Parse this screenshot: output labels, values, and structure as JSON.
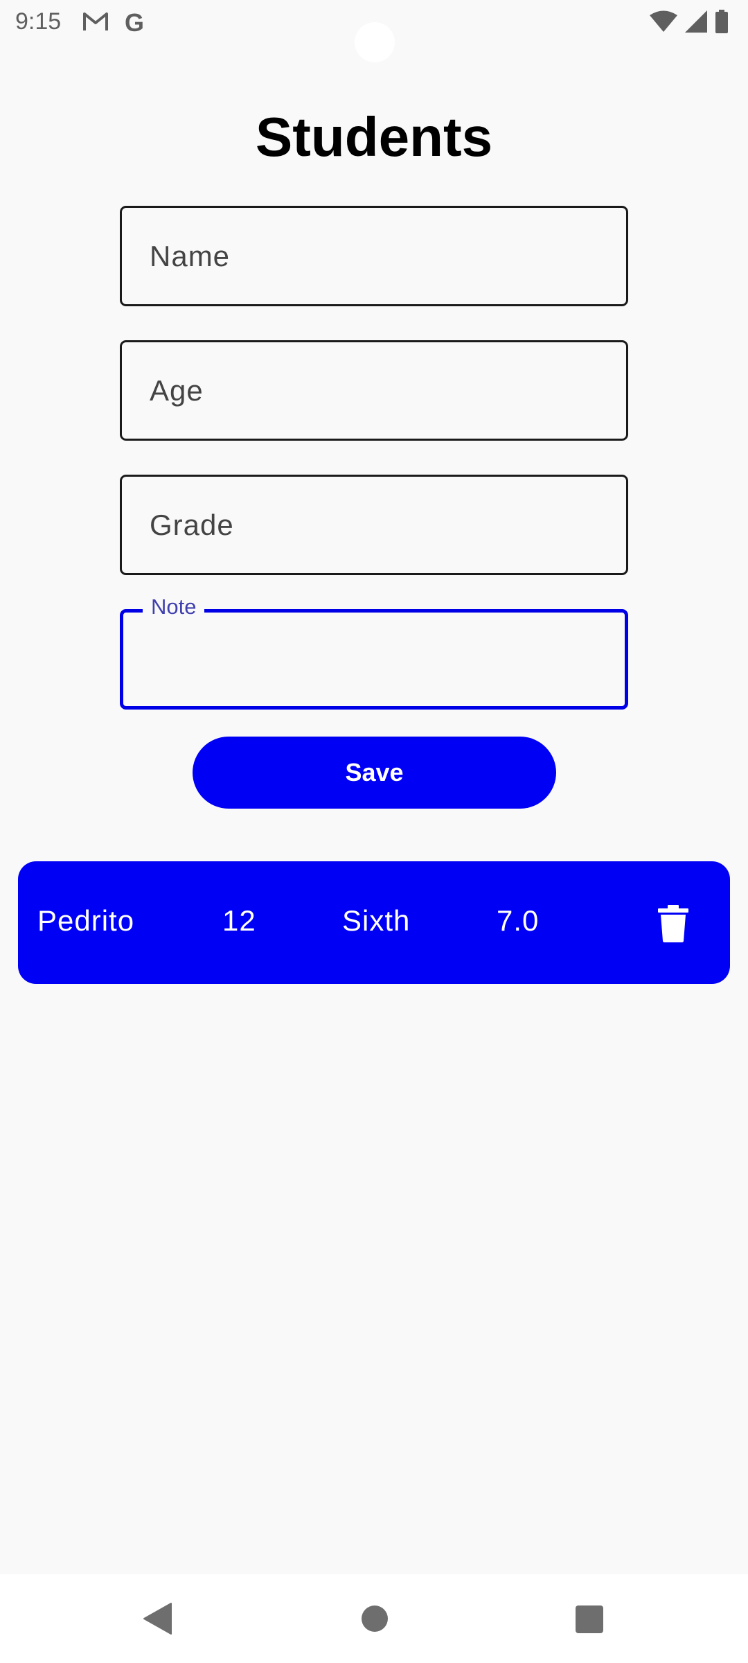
{
  "status_bar": {
    "time": "9:15",
    "google_glyph": "G",
    "left_icons": [
      "gmail-icon",
      "google-icon"
    ],
    "right_icons": [
      "wifi-icon",
      "signal-icon",
      "battery-icon"
    ]
  },
  "page": {
    "title": "Students"
  },
  "form": {
    "name_placeholder": "Name",
    "age_placeholder": "Age",
    "grade_placeholder": "Grade",
    "note_label": "Note",
    "note_value": "",
    "save_label": "Save"
  },
  "students": [
    {
      "name": "Pedrito",
      "age": "12",
      "grade": "Sixth",
      "note": "7.0",
      "action_icon": "trash-icon"
    }
  ],
  "colors": {
    "accent": "#0000f5",
    "focus_label": "#3f3fb0",
    "background": "#f9f9f9"
  },
  "nav_bar": {
    "icons": [
      "back-icon",
      "home-icon",
      "recents-icon"
    ]
  }
}
